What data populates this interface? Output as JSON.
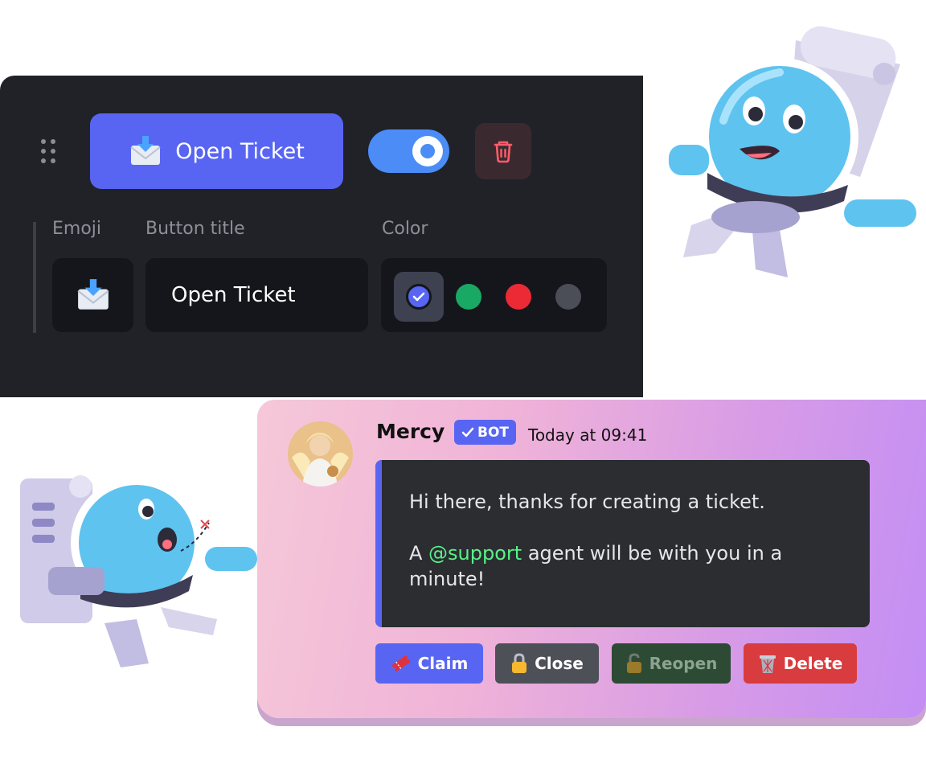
{
  "editor": {
    "button_preview_label": "Open Ticket",
    "button_preview_icon": "envelope-download-icon",
    "toggle_state": "on",
    "labels": {
      "emoji": "Emoji",
      "button_title": "Button title",
      "color": "Color"
    },
    "emoji_value_icon": "envelope-download-icon",
    "title_value": "Open Ticket",
    "colors": [
      {
        "name": "blurple",
        "hex": "#5865f2",
        "selected": true
      },
      {
        "name": "green",
        "hex": "#1aa865",
        "selected": false
      },
      {
        "name": "red",
        "hex": "#ec2a35",
        "selected": false
      },
      {
        "name": "grey",
        "hex": "#4b4e57",
        "selected": false
      }
    ]
  },
  "message": {
    "username": "Mercy",
    "badge": "BOT",
    "timestamp": "Today at 09:41",
    "embed_line1": "Hi there, thanks for creating a ticket.",
    "embed_pre": "A ",
    "mention": "@support",
    "embed_post": " agent will be with you in a minute!",
    "buttons": [
      {
        "label": "Claim",
        "icon": "ticket-icon",
        "color": "#5865f2"
      },
      {
        "label": "Close",
        "icon": "lock-icon",
        "color": "#4e5058"
      },
      {
        "label": "Reopen",
        "icon": "unlock-icon",
        "color": "#2d4a35"
      },
      {
        "label": "Delete",
        "icon": "trash-bin-icon",
        "color": "#d83c3e"
      }
    ]
  }
}
